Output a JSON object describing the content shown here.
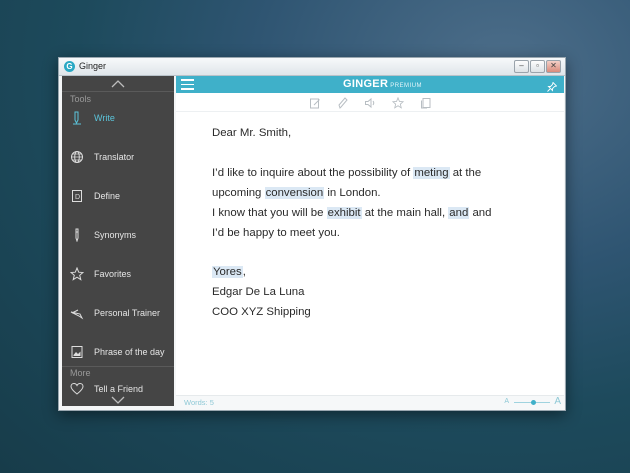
{
  "window": {
    "title": "Ginger"
  },
  "titlebar_buttons": [
    {
      "name": "minimize-button",
      "glyph": "–"
    },
    {
      "name": "restore-button",
      "glyph": "▫"
    },
    {
      "name": "close-button",
      "glyph": "✕"
    }
  ],
  "sidebar": {
    "tools_label": "Tools",
    "more_label": "More",
    "items": [
      {
        "label": "Write",
        "icon": "pen-icon",
        "active": true
      },
      {
        "label": "Translator",
        "icon": "globe-icon",
        "active": false
      },
      {
        "label": "Define",
        "icon": "dictionary-icon",
        "active": false
      },
      {
        "label": "Synonyms",
        "icon": "pencil-icon",
        "active": false
      },
      {
        "label": "Favorites",
        "icon": "star-icon",
        "active": false
      },
      {
        "label": "Personal Trainer",
        "icon": "brush-icon",
        "active": false
      },
      {
        "label": "Phrase of the day",
        "icon": "picture-icon",
        "active": false
      }
    ],
    "more_items": [
      {
        "label": "Tell a Friend",
        "icon": "heart-icon"
      }
    ]
  },
  "header": {
    "brand": "GINGER",
    "edition": "PREMIUM"
  },
  "toolbar_icons": [
    "edit-icon",
    "rephrase-icon",
    "speaker-icon",
    "favorite-icon",
    "copy-icon"
  ],
  "document": {
    "lines": [
      {
        "segments": [
          {
            "t": "Dear Mr. Smith,"
          }
        ]
      },
      {
        "segments": [
          {
            "t": "I’d like to inquire about the possibility of "
          },
          {
            "t": "meting",
            "hl": true
          },
          {
            "t": " at the"
          }
        ]
      },
      {
        "segments": [
          {
            "t": "upcoming "
          },
          {
            "t": "convension",
            "hl": true
          },
          {
            "t": " in London."
          }
        ]
      },
      {
        "segments": [
          {
            "t": "I know that you will be "
          },
          {
            "t": "exhibit",
            "hl": true
          },
          {
            "t": " at the main hall, "
          },
          {
            "t": "and",
            "hl": true
          },
          {
            "t": " and"
          }
        ]
      },
      {
        "segments": [
          {
            "t": "I’d be happy to meet you."
          }
        ]
      },
      {
        "segments": [
          {
            "t": "Yores",
            "hl": true
          },
          {
            "t": ","
          }
        ]
      },
      {
        "segments": [
          {
            "t": "Edgar De La Luna"
          }
        ]
      },
      {
        "segments": [
          {
            "t": "COO XYZ Shipping"
          }
        ]
      }
    ]
  },
  "status": {
    "words_label": "Words: 5",
    "zoom_small": "A",
    "zoom_large": "A",
    "zoom_level": 0.55
  },
  "colors": {
    "accent": "#3fb0c9",
    "sidebar_bg": "#454545",
    "highlight": "#dbe8f4"
  }
}
